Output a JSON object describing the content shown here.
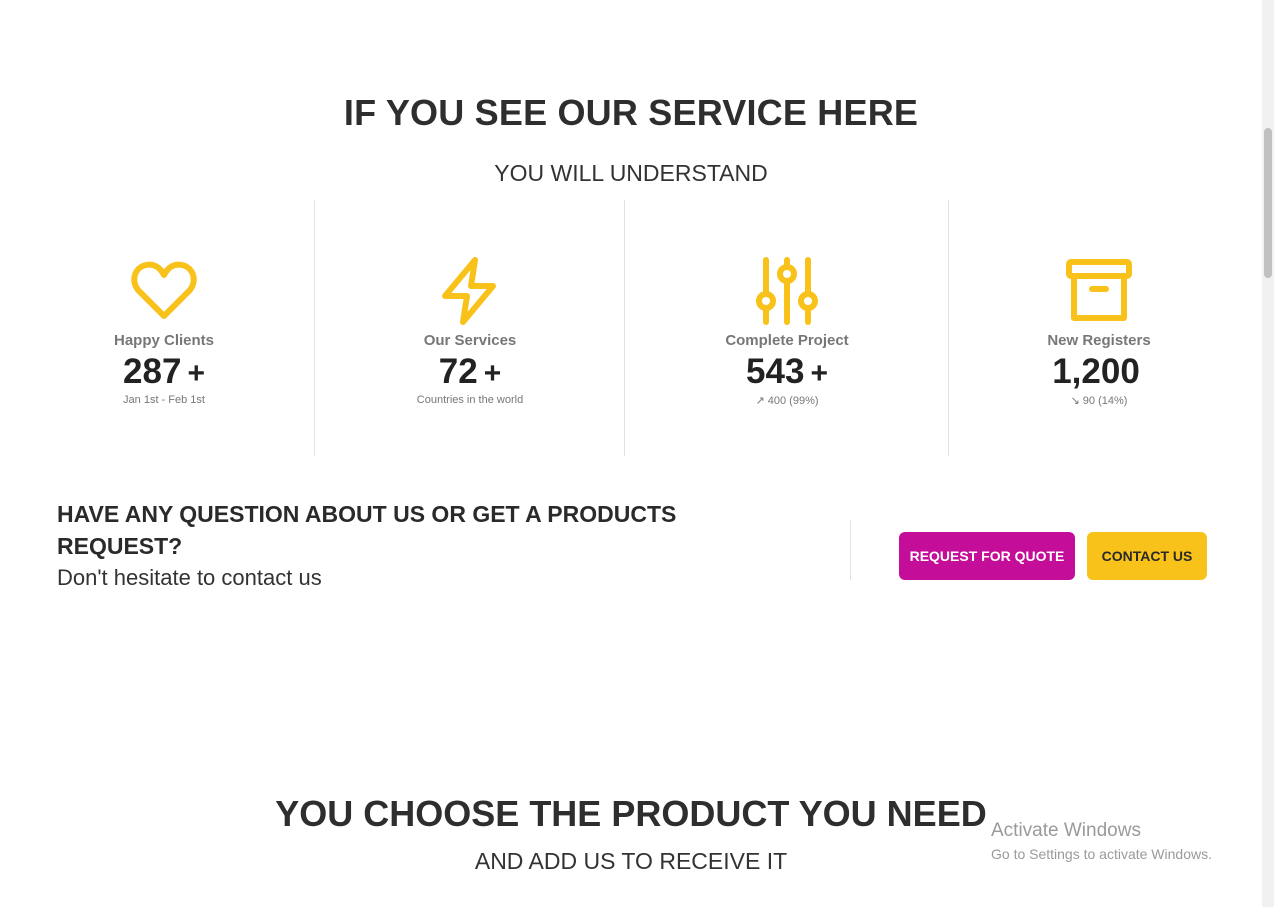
{
  "hero": {
    "title": "IF YOU SEE OUR SERVICE HERE",
    "subtitle": "YOU WILL UNDERSTAND"
  },
  "colors": {
    "accent_yellow": "#f9c21a",
    "accent_magenta": "#c40d98",
    "text_dark": "#2e2e2e",
    "text_muted": "#777777"
  },
  "stats": [
    {
      "icon": "heart-icon",
      "label": "Happy Clients",
      "value": "287",
      "plus": "+",
      "desc": "Jan 1st - Feb 1st"
    },
    {
      "icon": "lightning-icon",
      "label": "Our Services",
      "value": "72",
      "plus": "+",
      "desc": "Countries in the world"
    },
    {
      "icon": "sliders-icon",
      "label": "Complete Project",
      "value": "543",
      "plus": "+",
      "desc": "↗ 400 (99%)"
    },
    {
      "icon": "archive-box-icon",
      "label": "New Registers",
      "value": "1,200",
      "plus": "",
      "desc": "↘ 90 (14%)"
    }
  ],
  "cta": {
    "title": "HAVE ANY QUESTION ABOUT US OR GET A PRODUCTS REQUEST?",
    "text": "Don't hesitate to contact us",
    "quote_button": "REQUEST FOR QUOTE",
    "contact_button": "CONTACT US"
  },
  "section2": {
    "title": "YOU CHOOSE THE PRODUCT YOU NEED",
    "subtitle": "AND ADD US TO RECEIVE IT"
  },
  "watermark": {
    "title": "Activate Windows",
    "subtitle": "Go to Settings to activate Windows."
  }
}
